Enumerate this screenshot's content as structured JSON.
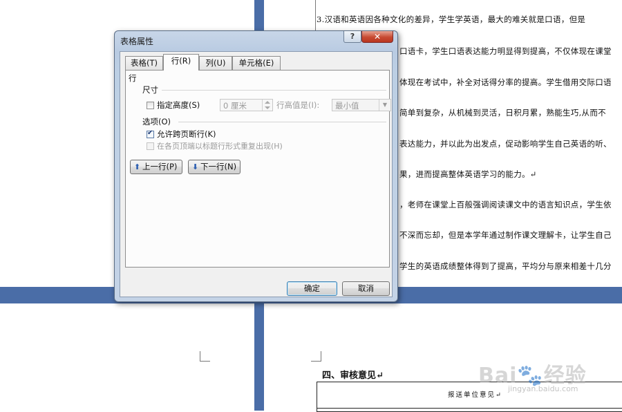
{
  "document": {
    "lines": [
      "3.汉语和英语因各种文化的差异，学生学英语，最大的难关就是口语，但是",
      "口语卡，学生口语表达能力明显得到提高，不仅体现在课堂",
      "体现在考试中，补全对话得分率的提高。学生借用交际口语",
      "简单到复杂，从机械到灵活，日积月累，熟能生巧,从而不",
      "表达能力，并以此为出发点，促动影响学生自己英语的听、",
      "果，进而提高整体英语学习的能力。↵",
      "，老师在课堂上百般强调阅读课文中的语言知识点，学生依",
      "不深而忘却，但是本学年通过制作课文理解卡，让学生自己",
      "学生的英语成绩整体得到了提高，平均分与原来相差十几分"
    ],
    "section_title": "四、审核意见↵",
    "review_cell": "报送单位意见↵",
    "watermark": "Bai🐾经验",
    "watermark_sub": "jingyan.baidu.com"
  },
  "dialog": {
    "title": "表格属性",
    "help_label": "?",
    "close_label": "✕",
    "tabs": [
      {
        "label": "表格(T)",
        "active": false
      },
      {
        "label": "行(R)",
        "active": true
      },
      {
        "label": "列(U)",
        "active": false
      },
      {
        "label": "单元格(E)",
        "active": false
      }
    ],
    "row_tab": {
      "group_label": "行",
      "size_label": "尺寸",
      "specify_height_label": "指定高度(S)",
      "specify_height_checked": false,
      "height_value": "0 厘米",
      "row_height_is_label": "行高值是(I):",
      "row_height_is_value": "最小值",
      "options_label": "选项(O)",
      "allow_break_label": "允许跨页断行(K)",
      "allow_break_checked": true,
      "repeat_header_label": "在各页顶端以标题行形式重复出现(H)",
      "repeat_header_checked": false,
      "prev_row_label": "上一行(P)",
      "next_row_label": "下一行(N)"
    },
    "ok_label": "确定",
    "cancel_label": "取消"
  },
  "colors": {
    "highlight_red": "#e2121e",
    "desktop_blue": "#4a6da7"
  }
}
